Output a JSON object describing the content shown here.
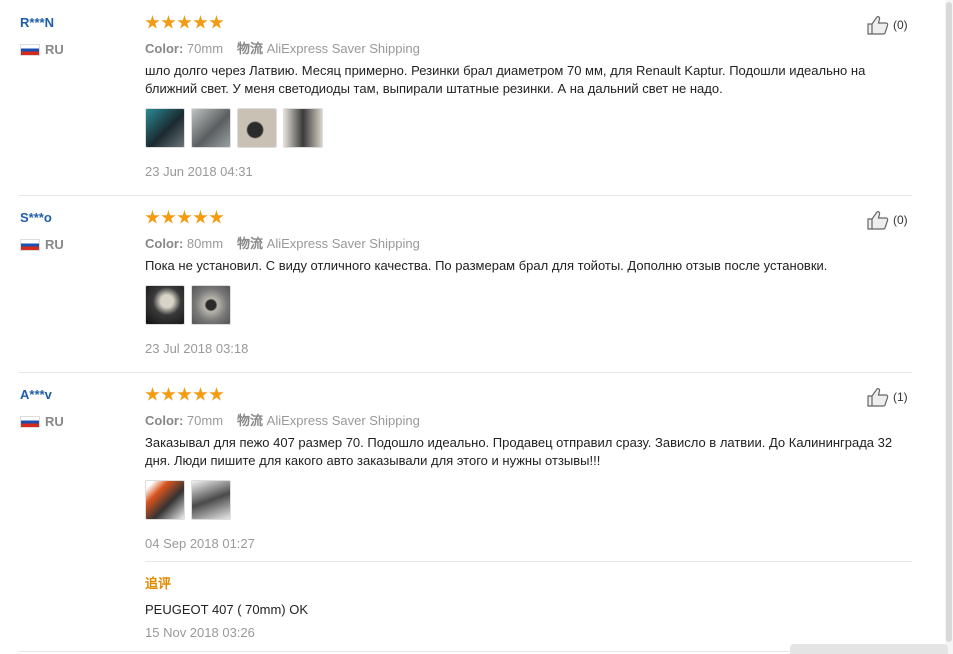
{
  "labels": {
    "color": "Color:",
    "shipping_cn": "物流",
    "follow_up": "追评"
  },
  "reviews": [
    {
      "user": "R***N",
      "country": "RU",
      "rating": 5,
      "color_value": "70mm",
      "shipping": "AliExpress Saver Shipping",
      "text": "шло долго через Латвию. Месяц примерно. Резинки брал диаметром 70 мм, для Renault Kaptur. Подошли идеально на ближний свет. У меня светодиоды там, выпирали штатные резинки. А на дальний свет не надо.",
      "date": "23 Jun 2018 04:31",
      "helpful": "(0)",
      "images": 4
    },
    {
      "user": "S***o",
      "country": "RU",
      "rating": 5,
      "color_value": "80mm",
      "shipping": "AliExpress Saver Shipping",
      "text": "Пока не установил. С виду отличного качества. По размерам брал для тойоты. Дополню отзыв после установки.",
      "date": "23 Jul 2018 03:18",
      "helpful": "(0)",
      "images": 2
    },
    {
      "user": "A***v",
      "country": "RU",
      "rating": 5,
      "color_value": "70mm",
      "shipping": "AliExpress Saver Shipping",
      "text": "Заказывал для пежо 407 размер 70. Подошло идеально. Продавец отправил сразу. Зависло в латвии. До Калининграда 32 дня. Люди пишите для какого авто заказывали для этого и нужны отзывы!!!",
      "date": "04 Sep 2018 01:27",
      "helpful": "(1)",
      "images": 2,
      "followup": {
        "text": "PEUGEOT 407 ( 70mm) OK",
        "date": "15 Nov 2018 03:26"
      }
    }
  ]
}
